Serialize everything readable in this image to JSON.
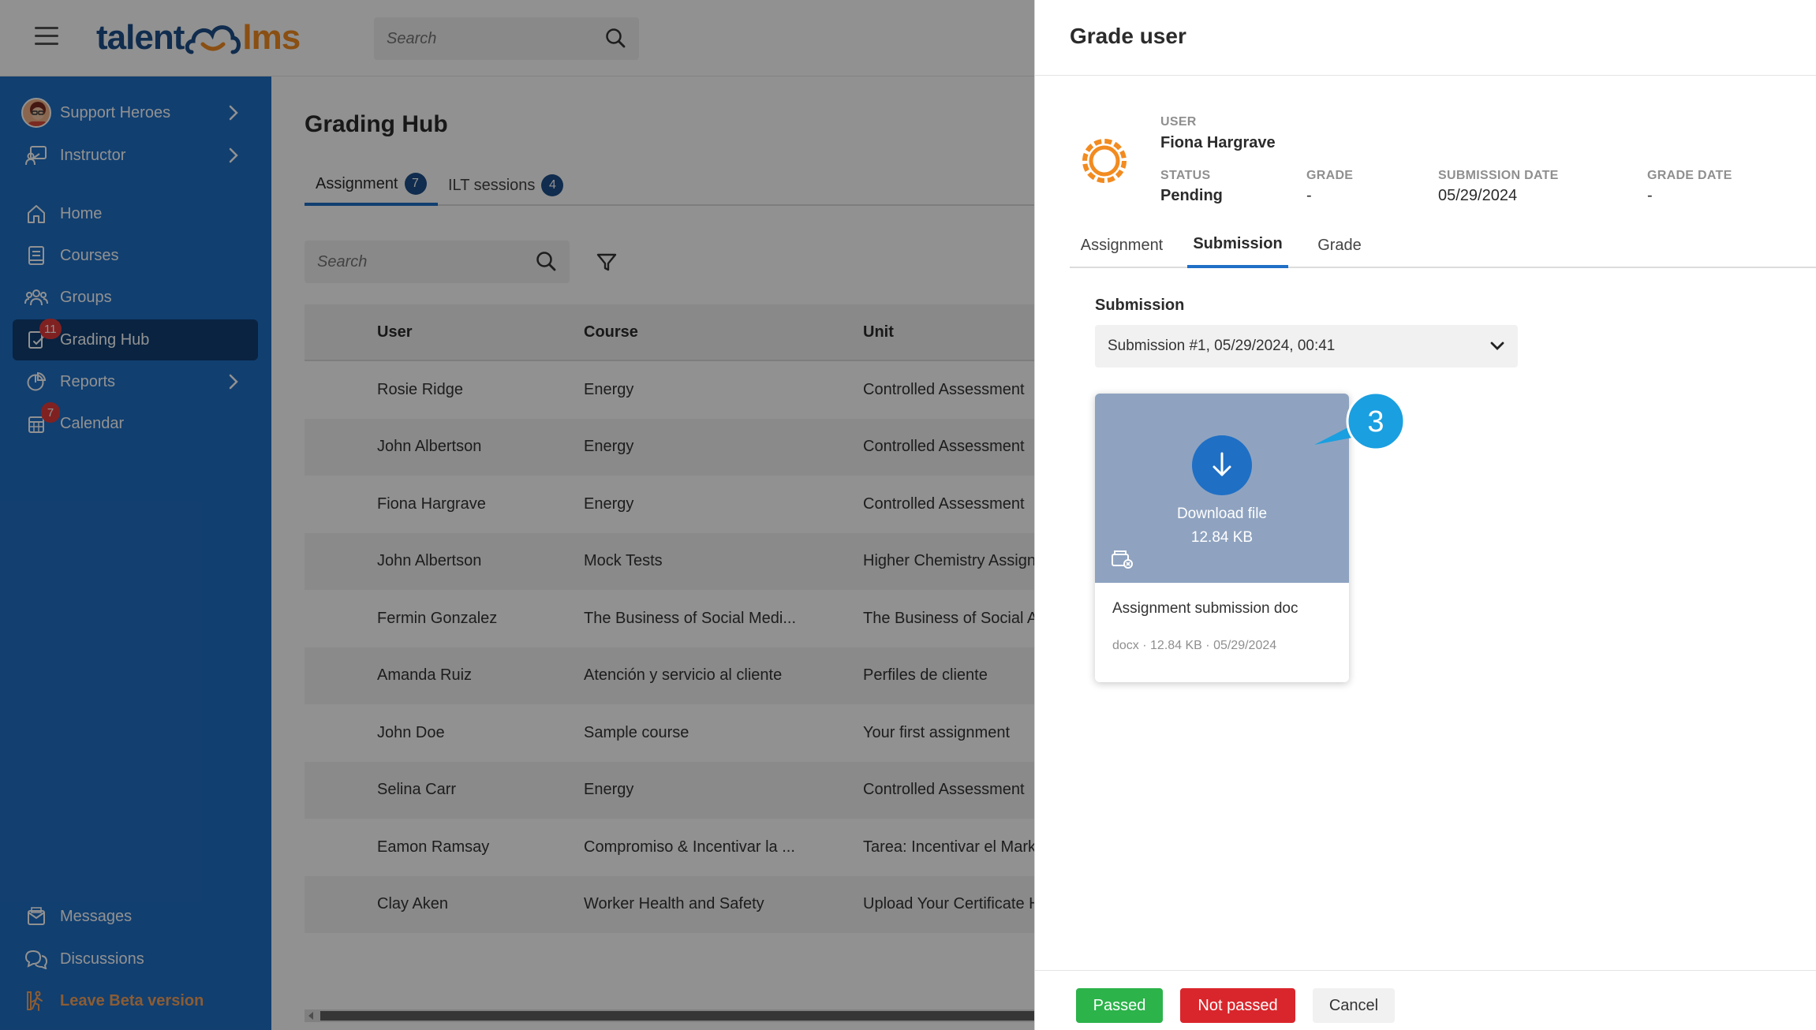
{
  "topbar": {
    "logo_left": "talent",
    "logo_right": "lms",
    "search_placeholder": "Search"
  },
  "sidebar": {
    "items": [
      {
        "label": "Support Heroes",
        "icon": "avatar"
      },
      {
        "label": "Instructor",
        "icon": "instructor-icon"
      },
      {
        "label": "Home",
        "icon": "home-icon"
      },
      {
        "label": "Courses",
        "icon": "courses-icon"
      },
      {
        "label": "Groups",
        "icon": "groups-icon"
      },
      {
        "label": "Grading Hub",
        "icon": "grading-hub-icon",
        "badge": "11"
      },
      {
        "label": "Reports",
        "icon": "reports-icon"
      },
      {
        "label": "Calendar",
        "icon": "calendar-icon",
        "badge": "7"
      },
      {
        "label": "Messages",
        "icon": "messages-icon"
      },
      {
        "label": "Discussions",
        "icon": "discussions-icon"
      },
      {
        "label": "Leave Beta version",
        "icon": "leave-beta-icon"
      }
    ]
  },
  "main": {
    "title": "Grading Hub",
    "tabs": [
      {
        "label": "Assignment",
        "count": "7"
      },
      {
        "label": "ILT sessions",
        "count": "4"
      }
    ],
    "search_placeholder": "Search",
    "table": {
      "headers": [
        "User",
        "Course",
        "Unit"
      ],
      "rows": [
        [
          "Rosie Ridge",
          "Energy",
          "Controlled Assessment"
        ],
        [
          "John Albertson",
          "Energy",
          "Controlled Assessment"
        ],
        [
          "Fiona Hargrave",
          "Energy",
          "Controlled Assessment"
        ],
        [
          "John Albertson",
          "Mock Tests",
          "Higher Chemistry Assignme"
        ],
        [
          "Fermin Gonzalez",
          "The Business of Social Medi...",
          "The Business of Social Assig"
        ],
        [
          "Amanda Ruiz",
          "Atención y servicio al cliente",
          "Perfiles de cliente"
        ],
        [
          "John Doe",
          "Sample course",
          "Your first assignment"
        ],
        [
          "Selina Carr",
          "Energy",
          "Controlled Assessment"
        ],
        [
          "Eamon Ramsay",
          "Compromiso & Incentivar la ...",
          "Tarea: Incentivar el Marketin"
        ],
        [
          "Clay Aken",
          "Worker Health and Safety",
          "Upload Your Certificate Here"
        ]
      ]
    }
  },
  "panel": {
    "title": "Grade user",
    "user_label": "USER",
    "user_value": "Fiona Hargrave",
    "status_label": "STATUS",
    "status_value": "Pending",
    "grade_label": "GRADE",
    "grade_value": "-",
    "submission_date_label": "SUBMISSION DATE",
    "submission_date_value": "05/29/2024",
    "grade_date_label": "GRADE DATE",
    "grade_date_value": "-",
    "tabs": [
      "Assignment",
      "Submission",
      "Grade"
    ],
    "active_tab": "Submission",
    "submission_label": "Submission",
    "submission_selected": "Submission #1, 05/29/2024, 00:41",
    "file": {
      "download_label": "Download file",
      "size": "12.84 KB",
      "name": "Assignment submission doc",
      "meta": "docx  ·  12.84 KB  ·  05/29/2024"
    },
    "callout_number": "3",
    "buttons": {
      "passed": "Passed",
      "not_passed": "Not passed",
      "cancel": "Cancel"
    }
  },
  "colors": {
    "sidebar": "#1f6fc5",
    "sidebar_active": "#103f73",
    "brand_blue": "#1d4e89",
    "brand_orange": "#f28b20",
    "passed": "#2cb34a",
    "not_passed": "#d9262c",
    "callout": "#1a9fe0"
  }
}
